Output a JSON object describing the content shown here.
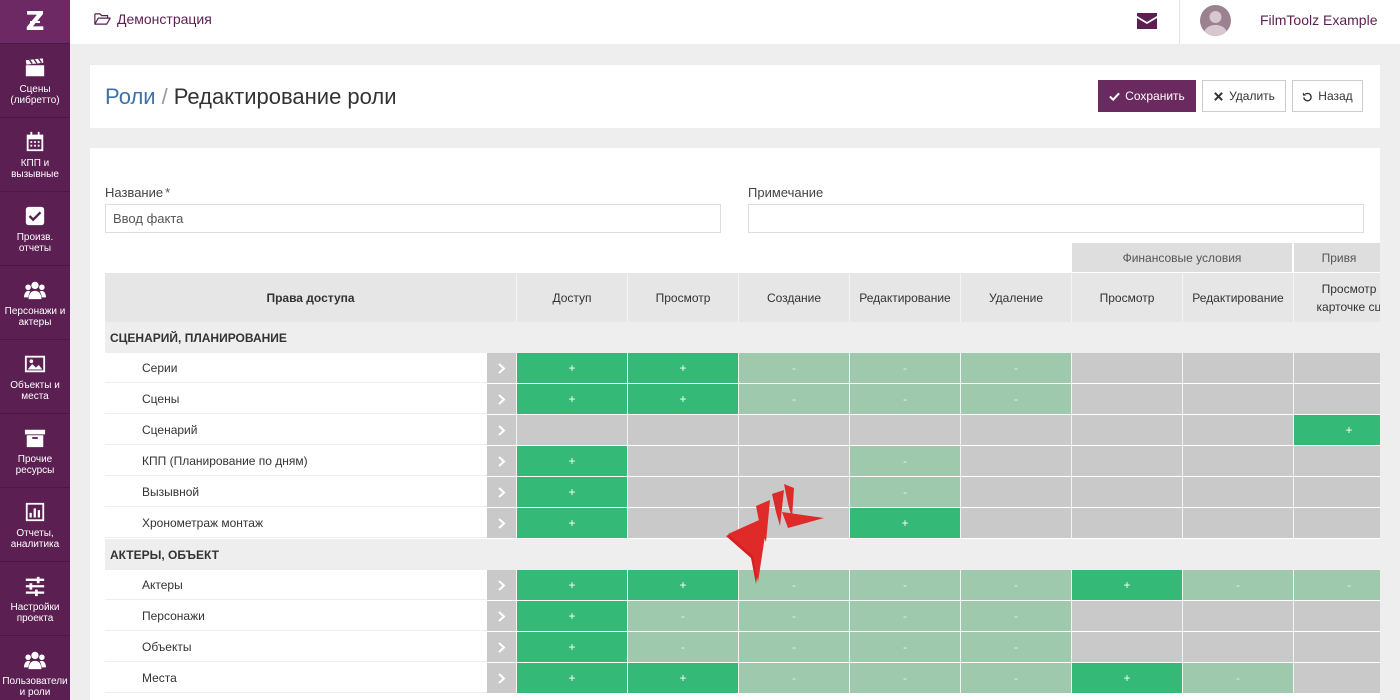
{
  "app": {
    "logo_letter": "Z"
  },
  "sidebar": {
    "items": [
      {
        "label": "Сцены (либретто)",
        "icon": "clapperboard-icon"
      },
      {
        "label": "КПП и вызывные",
        "icon": "calendar-icon"
      },
      {
        "label": "Произв. отчеты",
        "icon": "checkbox-icon"
      },
      {
        "label": "Персонажи и актеры",
        "icon": "users-icon"
      },
      {
        "label": "Объекты и места",
        "icon": "image-icon"
      },
      {
        "label": "Прочие ресурсы",
        "icon": "archive-icon"
      },
      {
        "label": "Отчеты, аналитика",
        "icon": "bar-chart-icon"
      },
      {
        "label": "Настройки проекта",
        "icon": "sliders-icon"
      },
      {
        "label": "Пользователи и роли",
        "icon": "users-group-icon"
      }
    ]
  },
  "header": {
    "breadcrumb": "Демонстрация",
    "username": "FilmToolz Example"
  },
  "page": {
    "title_link": "Роли",
    "title_separator": "/",
    "title_current": "Редактирование роли",
    "buttons": {
      "save": "Сохранить",
      "delete": "Удалить",
      "back": "Назад"
    }
  },
  "form": {
    "name_label": "Название",
    "name_required_mark": "*",
    "name_value": "Ввод факта",
    "note_label": "Примечание",
    "note_value": ""
  },
  "table": {
    "groups": [
      "Финансовые условия",
      "Привя"
    ],
    "columns": [
      "Права доступа",
      "Доступ",
      "Просмотр",
      "Создание",
      "Редактирование",
      "Удаление",
      "Просмотр",
      "Редактирование",
      "Просмотр карточке сц"
    ],
    "col_extra_line1": "Просмотр",
    "col_extra_line2": "карточке сц",
    "sections": [
      {
        "title": "СЦЕНАРИЙ, ПЛАНИРОВАНИЕ",
        "rows": [
          {
            "label": "Серии",
            "cells": [
              "+",
              "+",
              "-",
              "-",
              "-",
              "",
              "",
              ""
            ]
          },
          {
            "label": "Сцены",
            "cells": [
              "+",
              "+",
              "-",
              "-",
              "-",
              "",
              "",
              ""
            ]
          },
          {
            "label": "Сценарий",
            "cells": [
              "",
              "",
              "",
              "",
              "",
              "",
              "",
              "+"
            ]
          },
          {
            "label": "КПП (Планирование по дням)",
            "cells": [
              "+",
              "",
              "",
              "-",
              "",
              "",
              "",
              ""
            ]
          },
          {
            "label": "Вызывной",
            "cells": [
              "+",
              "",
              "",
              "-",
              "",
              "",
              "",
              ""
            ]
          },
          {
            "label": "Хронометраж монтаж",
            "cells": [
              "+",
              "",
              "",
              "+",
              "",
              "",
              "",
              ""
            ]
          }
        ]
      },
      {
        "title": "АКТЕРЫ, ОБЪЕКТ",
        "rows": [
          {
            "label": "Актеры",
            "cells": [
              "+",
              "+",
              "-",
              "-",
              "-",
              "+",
              "-",
              "-"
            ]
          },
          {
            "label": "Персонажи",
            "cells": [
              "+",
              "-",
              "-",
              "-",
              "-",
              "",
              "",
              ""
            ]
          },
          {
            "label": "Объекты",
            "cells": [
              "+",
              "-",
              "-",
              "-",
              "-",
              "",
              "",
              ""
            ]
          },
          {
            "label": "Места",
            "cells": [
              "+",
              "+",
              "-",
              "-",
              "-",
              "+",
              "-",
              ""
            ]
          }
        ]
      }
    ]
  },
  "colors": {
    "sidebar_bg": "#5b1f52",
    "accent": "#6b2a5f",
    "green_active": "#35b977",
    "green_inactive": "#9ec9ad",
    "cell_empty": "#c9c9c9",
    "annotation_red": "#e02a2a"
  }
}
